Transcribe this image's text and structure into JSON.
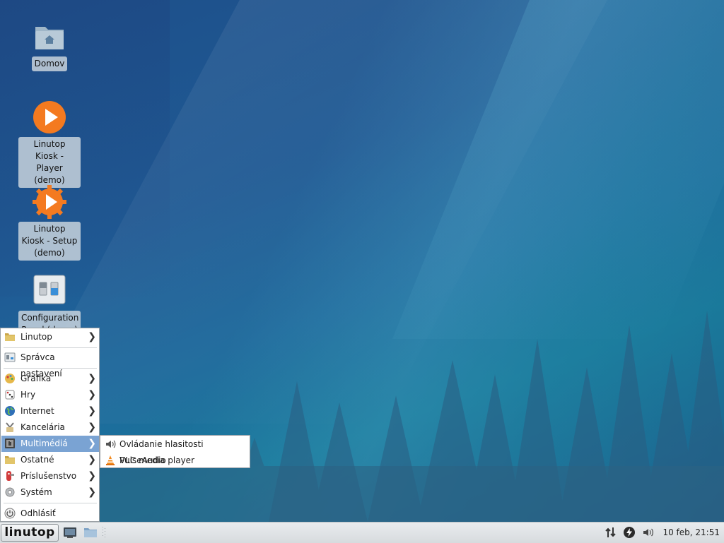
{
  "desktop": {
    "icons": [
      {
        "label": "Domov",
        "icon": "home-folder-icon"
      },
      {
        "label": "Linutop Kiosk - Player (demo)",
        "icon": "kiosk-player-icon"
      },
      {
        "label": "Linutop Kiosk - Setup (demo)",
        "icon": "kiosk-setup-icon"
      },
      {
        "label": "Configuration Panel (demo)",
        "icon": "configuration-panel-icon"
      }
    ]
  },
  "menu": {
    "items": [
      {
        "label": "Linutop",
        "icon": "linutop-folder-icon",
        "has_submenu": true
      },
      {
        "label": "Správca nastavení",
        "icon": "settings-manager-icon",
        "has_submenu": false
      },
      {
        "label": "Grafika",
        "icon": "graphics-icon",
        "has_submenu": true
      },
      {
        "label": "Hry",
        "icon": "games-icon",
        "has_submenu": true
      },
      {
        "label": "Internet",
        "icon": "internet-globe-icon",
        "has_submenu": true
      },
      {
        "label": "Kancelária",
        "icon": "office-icon",
        "has_submenu": true
      },
      {
        "label": "Multimédiá",
        "icon": "multimedia-icon",
        "has_submenu": true,
        "active": true
      },
      {
        "label": "Ostatné",
        "icon": "other-folder-icon",
        "has_submenu": true
      },
      {
        "label": "Príslušenstvo",
        "icon": "accessories-icon",
        "has_submenu": true
      },
      {
        "label": "Systém",
        "icon": "system-gear-icon",
        "has_submenu": true
      },
      {
        "label": "Odhlásiť",
        "icon": "logout-power-icon",
        "has_submenu": false
      }
    ],
    "submenu": [
      {
        "label": "Ovládanie hlasitosti PulseAudio",
        "icon": "speaker-icon"
      },
      {
        "label": "VLC media player",
        "icon": "vlc-cone-icon"
      }
    ]
  },
  "taskbar": {
    "start_label": "Linutop",
    "clock": "10 feb, 21:51"
  },
  "colors": {
    "menu_highlight": "#7aa3d3",
    "kiosk_orange": "#f47a20"
  }
}
